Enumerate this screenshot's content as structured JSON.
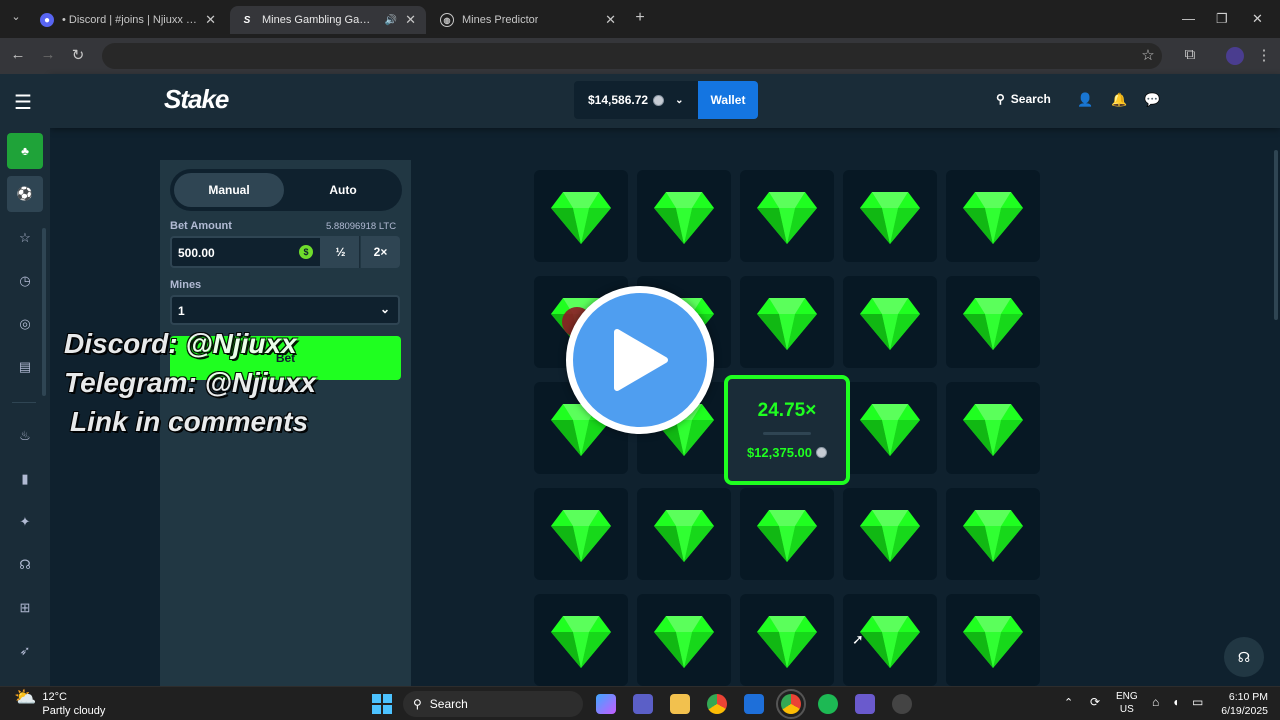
{
  "browser": {
    "tabs": [
      {
        "title": "• Discord | #joins | Njiuxx Syste",
        "icon": "discord-icon"
      },
      {
        "title": "Mines Gambling Game - Pl",
        "icon": "stake-icon"
      },
      {
        "title": "Mines Predictor",
        "icon": "globe-icon"
      }
    ],
    "new_tab": "+"
  },
  "header": {
    "logo": "Stake",
    "balance": "$14,586.72",
    "wallet": "Wallet",
    "search": "Search"
  },
  "controls": {
    "mode_manual": "Manual",
    "mode_auto": "Auto",
    "bet_amount_label": "Bet Amount",
    "bet_amount_crypto": "5.88096918 LTC",
    "bet_amount_value": "500.00",
    "half": "½",
    "double": "2×",
    "mines_label": "Mines",
    "mines_value": "1",
    "bet_button": "Bet"
  },
  "board": {
    "rows": 5,
    "cols": 5,
    "tile_content": "gem",
    "gem_color": "#1fff20",
    "win_multiplier": "24.75×",
    "win_amount": "$12,375.00"
  },
  "overlay_text": {
    "line1": "Discord: @Njiuxx",
    "line2": "Telegram: @Njiuxx",
    "line3": "Link in comments"
  },
  "taskbar": {
    "temperature": "12°C",
    "condition": "Partly cloudy",
    "search": "Search",
    "lang1": "ENG",
    "lang2": "US",
    "time": "6:10 PM",
    "date": "6/19/2025"
  },
  "colors": {
    "accent_green": "#1fff20",
    "wallet_blue": "#1475e1",
    "bg_dark": "#0f212e",
    "panel": "#213743"
  }
}
